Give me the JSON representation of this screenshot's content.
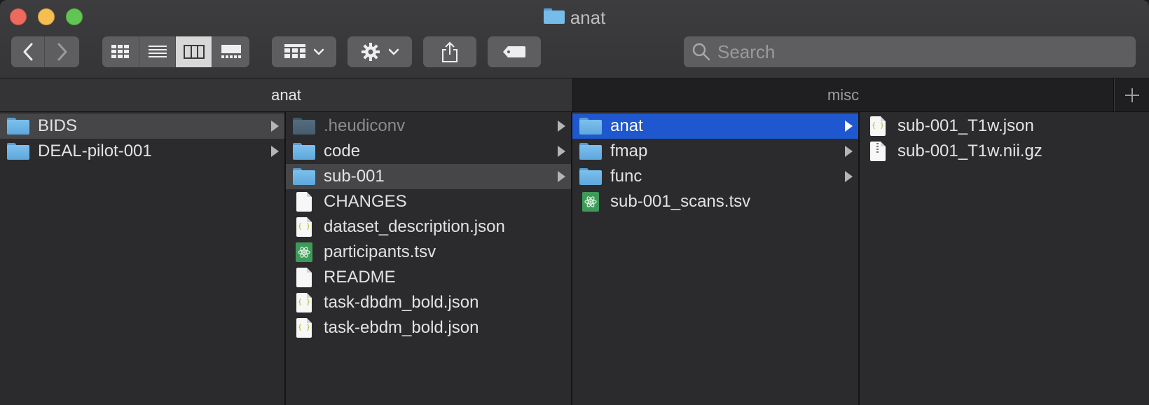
{
  "window": {
    "title": "anat"
  },
  "toolbar": {
    "back_icon": "chevron-left-icon",
    "forward_icon": "chevron-right-icon",
    "view_modes": [
      "icon-view",
      "list-view",
      "column-view",
      "gallery-view"
    ],
    "active_view": "column-view",
    "group_icon": "group-by-icon",
    "action_icon": "gear-icon",
    "share_icon": "share-icon",
    "tags_icon": "tag-icon"
  },
  "search": {
    "placeholder": "Search"
  },
  "tabs": [
    {
      "label": "anat",
      "active": true
    },
    {
      "label": "misc",
      "active": false
    }
  ],
  "columns": [
    {
      "items": [
        {
          "name": "BIDS",
          "type": "folder",
          "has_children": true,
          "state": "selected-inactive"
        },
        {
          "name": "DEAL-pilot-001",
          "type": "folder",
          "has_children": true,
          "state": ""
        }
      ]
    },
    {
      "items": [
        {
          "name": ".heudiconv",
          "type": "folder-hidden",
          "has_children": true,
          "state": "dim"
        },
        {
          "name": "code",
          "type": "folder",
          "has_children": true,
          "state": ""
        },
        {
          "name": "sub-001",
          "type": "folder",
          "has_children": true,
          "state": "selected-inactive"
        },
        {
          "name": "CHANGES",
          "type": "file",
          "has_children": false,
          "state": ""
        },
        {
          "name": "dataset_description.json",
          "type": "json",
          "has_children": false,
          "state": ""
        },
        {
          "name": "participants.tsv",
          "type": "tsv",
          "has_children": false,
          "state": ""
        },
        {
          "name": "README",
          "type": "file",
          "has_children": false,
          "state": ""
        },
        {
          "name": "task-dbdm_bold.json",
          "type": "json",
          "has_children": false,
          "state": ""
        },
        {
          "name": "task-ebdm_bold.json",
          "type": "json",
          "has_children": false,
          "state": ""
        }
      ]
    },
    {
      "items": [
        {
          "name": "anat",
          "type": "folder",
          "has_children": true,
          "state": "selected-active"
        },
        {
          "name": "fmap",
          "type": "folder",
          "has_children": true,
          "state": ""
        },
        {
          "name": "func",
          "type": "folder",
          "has_children": true,
          "state": ""
        },
        {
          "name": "sub-001_scans.tsv",
          "type": "tsv",
          "has_children": false,
          "state": ""
        }
      ]
    },
    {
      "items": [
        {
          "name": "sub-001_T1w.json",
          "type": "json",
          "has_children": false,
          "state": ""
        },
        {
          "name": "sub-001_T1w.nii.gz",
          "type": "archive",
          "has_children": false,
          "state": ""
        }
      ]
    }
  ],
  "colors": {
    "selection_active": "#1f57cf",
    "selection_inactive": "#464648",
    "folder": "#6fb3e6"
  }
}
